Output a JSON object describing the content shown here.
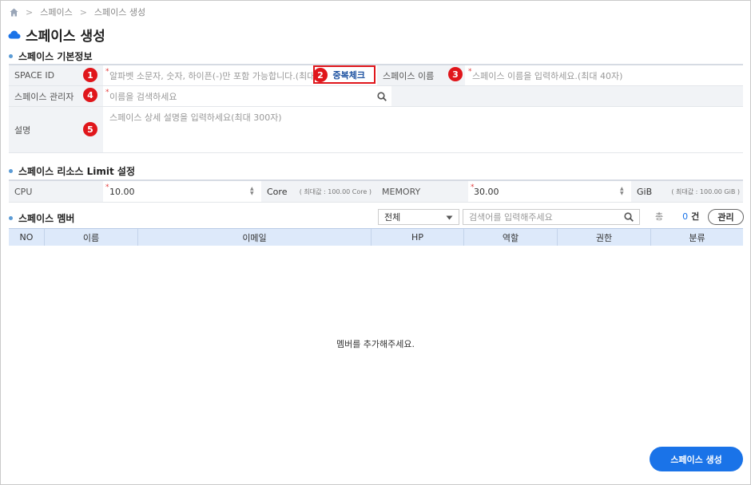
{
  "breadcrumb": {
    "items": [
      "스페이스",
      "스페이스 생성"
    ],
    "home_icon": "home-icon"
  },
  "page": {
    "title": "스페이스 생성",
    "title_icon": "cloud-icon"
  },
  "basic_info": {
    "section_title": "스페이스 기본정보",
    "space_id": {
      "label": "SPACE ID",
      "required_mark": "*",
      "placeholder": "알파벳 소문자, 숫자, 하이픈(-)만 포함 가능합니다.(최대",
      "badge": "1"
    },
    "duplicate_check": {
      "label": "중복체크",
      "badge": "2"
    },
    "space_name": {
      "label": "스페이스 이름",
      "required_mark": "*",
      "placeholder": "스페이스 이름을 입력하세요.(최대 40자)",
      "badge": "3"
    },
    "manager": {
      "label": "스페이스 관리자",
      "required_mark": "*",
      "placeholder": "이름을 검색하세요",
      "badge": "4",
      "icon": "search-icon"
    },
    "description": {
      "label": "설명",
      "placeholder": "스페이스 상세 설명을 입력하세요(최대 300자)",
      "badge": "5"
    }
  },
  "limits": {
    "section_title": "스페이스 리소스 Limit 설정",
    "cpu": {
      "label": "CPU",
      "required_mark": "*",
      "value": "10.00",
      "unit": "Core",
      "max_hint": "( 최대값 : 100.00 Core )"
    },
    "memory": {
      "label": "MEMORY",
      "required_mark": "*",
      "value": "30.00",
      "unit": "GiB",
      "max_hint": "( 최대값 : 100.00 GiB )"
    }
  },
  "members": {
    "section_title": "스페이스 멤버",
    "filter_selected": "전체",
    "search_placeholder": "검색어를 입력해주세요",
    "total_label": "총",
    "total_count": "0",
    "count_unit": "건",
    "manage_label": "관리",
    "columns": [
      "NO",
      "이름",
      "이메일",
      "HP",
      "역할",
      "권한",
      "분류"
    ],
    "empty_message": "멤버를 추가해주세요."
  },
  "footer": {
    "create_label": "스페이스 생성"
  },
  "colors": {
    "accent": "#1a73e8",
    "badge": "#e0161b",
    "header_bg": "#dde9fa",
    "label_bg": "#f1f3f6",
    "section_dot": "#5b9bd5"
  }
}
